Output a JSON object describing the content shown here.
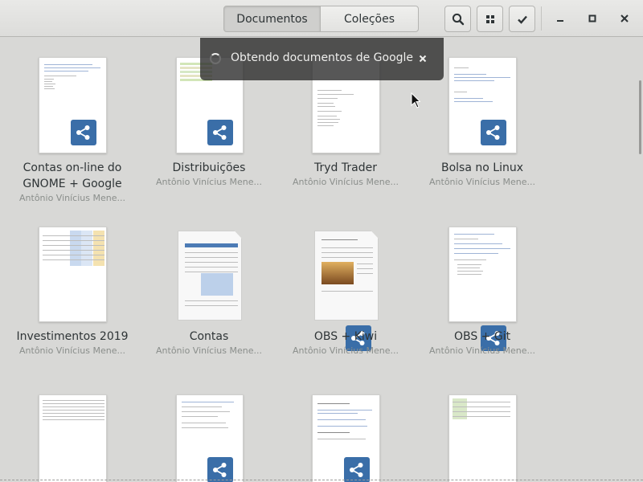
{
  "header": {
    "tabs": [
      {
        "label": "Documentos",
        "active": true
      },
      {
        "label": "Coleções",
        "active": false
      }
    ],
    "buttons": [
      "search-icon",
      "grid-view-icon",
      "select-check-icon"
    ],
    "window_controls": [
      "minimize-icon",
      "maximize-icon",
      "close-icon"
    ]
  },
  "notification": {
    "message": "Obtendo documentos de Google",
    "close_label": "×"
  },
  "documents": [
    {
      "title": "Contas on-line do GNOME + Google",
      "author": "Antônio Vinícius Mene...",
      "shared": true
    },
    {
      "title": "Distribuições",
      "author": "Antônio Vinícius Mene...",
      "shared": true
    },
    {
      "title": "Tryd Trader",
      "author": "Antônio Vinícius Mene...",
      "shared": false
    },
    {
      "title": "Bolsa no Linux",
      "author": "Antônio Vinícius Mene...",
      "shared": true
    },
    {
      "title": "Investimentos 2019",
      "author": "Antônio Vinícius Mene...",
      "shared": false
    },
    {
      "title": "Contas",
      "author": "Antônio Vinícius Mene...",
      "shared": false
    },
    {
      "title": "OBS + Kiwi",
      "author": "Antônio Vinícius Mene...",
      "shared": true
    },
    {
      "title": "OBS + Git",
      "author": "Antônio Vinícius Mene...",
      "shared": true
    },
    {
      "title": "",
      "author": "",
      "shared": false
    },
    {
      "title": "",
      "author": "",
      "shared": true
    },
    {
      "title": "",
      "author": "",
      "shared": true
    },
    {
      "title": "",
      "author": "",
      "shared": false
    }
  ],
  "colors": {
    "accent": "#3a6ea8",
    "header_bg": "#e4e4e2",
    "content_bg": "#d8d8d6",
    "notification_bg": "#2b2b2b"
  }
}
